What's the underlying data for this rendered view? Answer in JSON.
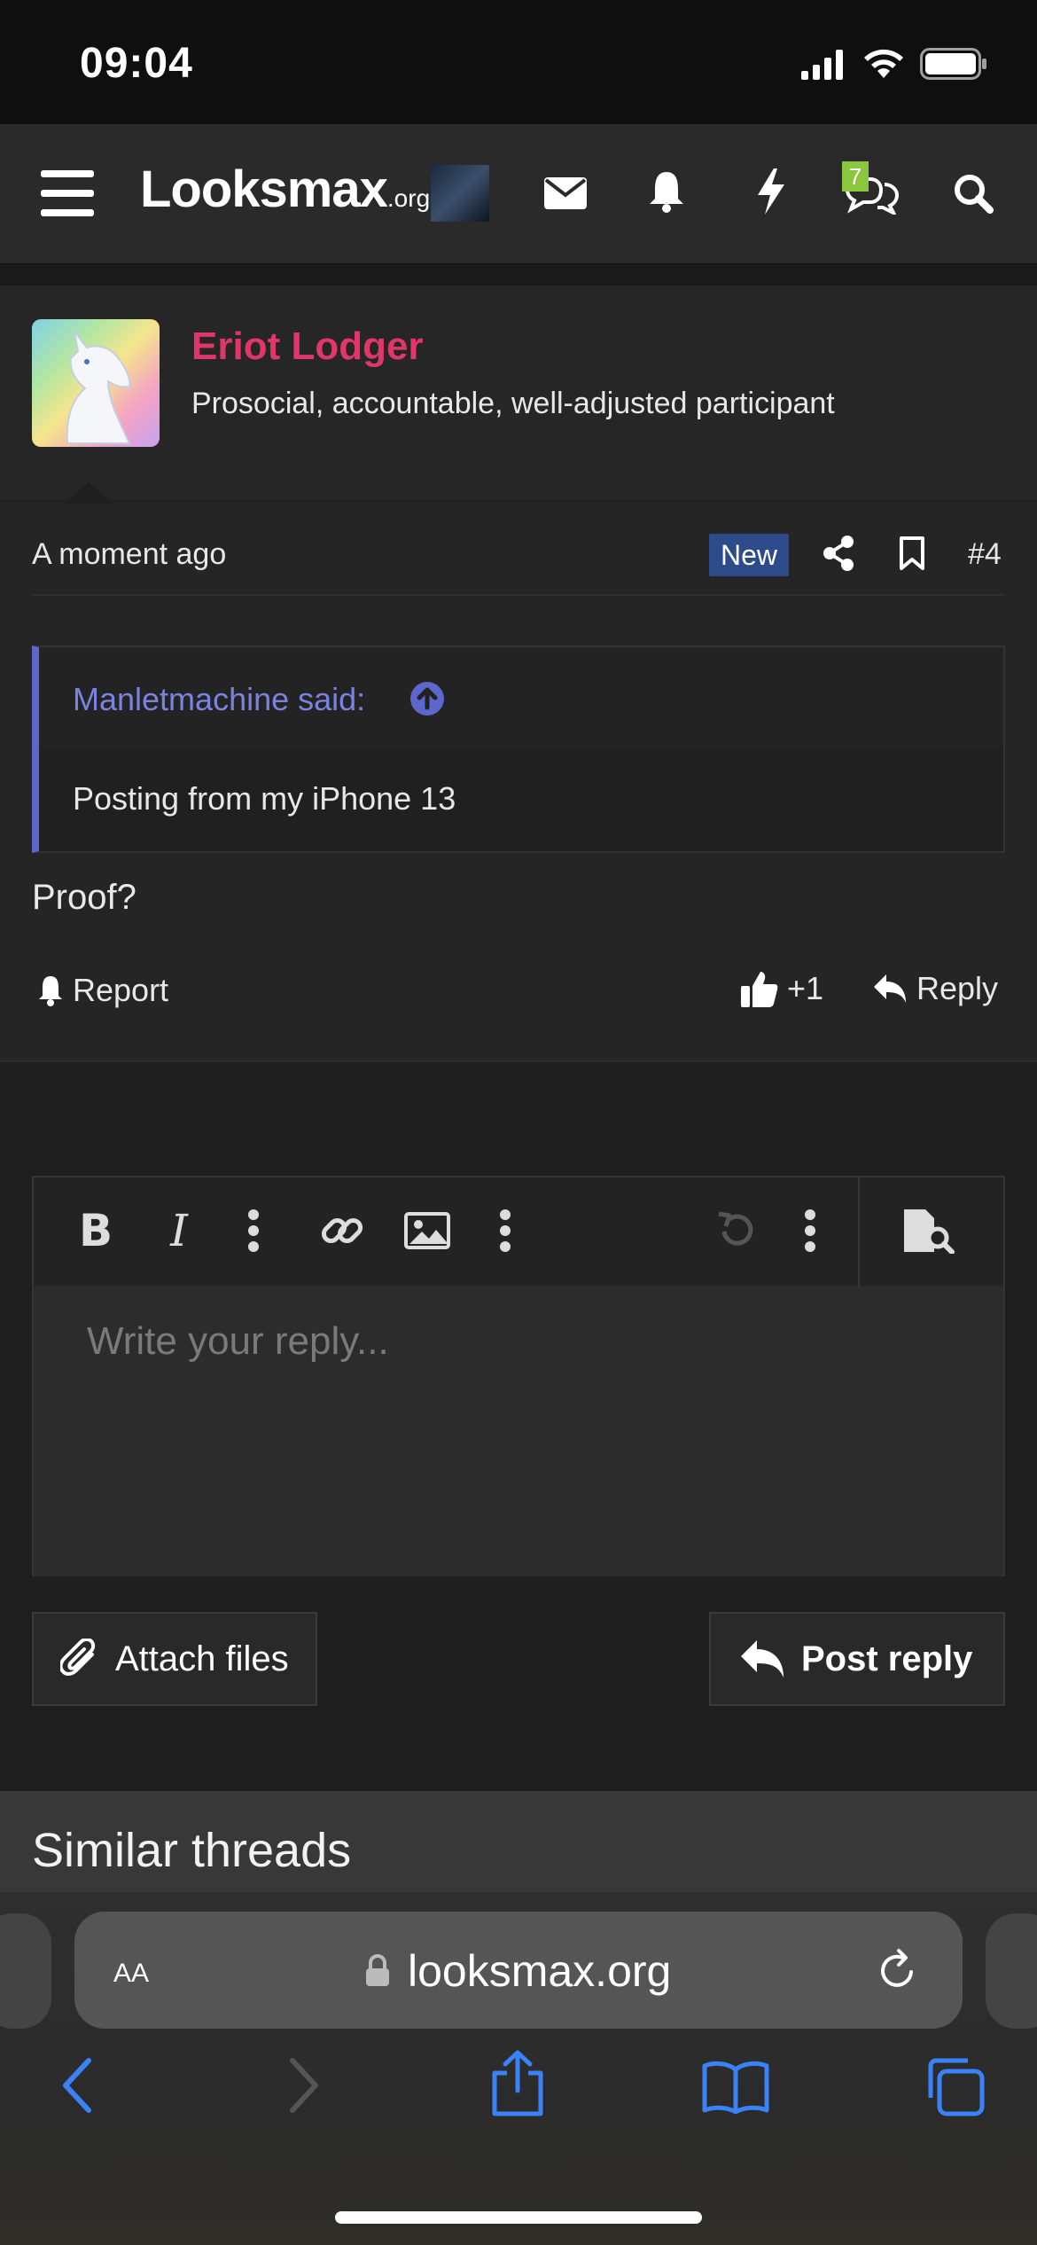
{
  "status_bar": {
    "time": "09:04"
  },
  "header": {
    "logo_main": "Looksmax",
    "logo_suffix": ".org",
    "chat_badge": "7",
    "icons": [
      "menu-icon",
      "envelope-icon",
      "bell-icon",
      "bolt-icon",
      "chat-bubbles-icon",
      "search-icon"
    ]
  },
  "post": {
    "username": "Eriot Lodger",
    "user_title": "Prosocial, accountable, well-adjusted participant",
    "time": "A moment ago",
    "new_badge": "New",
    "post_number": "#4",
    "quote": {
      "author_line": "Manletmachine said:",
      "text": "Posting from my iPhone 13"
    },
    "body": "Proof?",
    "report_label": "Report",
    "reaction_count": "+1",
    "reply_label": "Reply"
  },
  "editor": {
    "placeholder": "Write your reply...",
    "attach_label": "Attach files",
    "post_reply_label": "Post reply"
  },
  "similar": {
    "title": "Similar threads"
  },
  "browser": {
    "text_size_label": "AA",
    "url": "looksmax.org"
  },
  "colors": {
    "username": "#e0366a",
    "quote_accent": "#5d66cc",
    "new_badge": "#2d4a8a",
    "chat_badge": "#8cc63f",
    "safari_blue": "#3a82f7"
  }
}
